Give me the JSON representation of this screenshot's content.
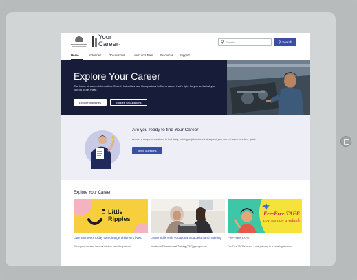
{
  "brand": {
    "name_line1": "Your",
    "name_line2": "Career",
    "trademark": "™"
  },
  "search": {
    "placeholder": "Search",
    "button_label": "Search"
  },
  "nav": {
    "items": [
      "Home",
      "Industries",
      "Occupations",
      "Learn and Train",
      "Resources",
      "Support"
    ],
    "active_index": 0
  },
  "hero": {
    "title": "Explore Your Career",
    "description": "The home of career information. Search Industries and Occupations to find a career that's right for you and what you can do to get there.",
    "button_industries": "Explore Industries",
    "button_occupations": "Explore Occupations"
  },
  "ready": {
    "title": "Are you ready to find Your Career",
    "description": "Answer a couple of questions to find study, training or job options that support your current career needs or goals.",
    "button_label": "Begin questions"
  },
  "explore": {
    "title": "Explore Your Career",
    "cards": [
      {
        "image_text_line1": "Little",
        "image_text_line2": "Ripples",
        "link": "Little moments today can change children's lives.",
        "text": "The experiences we have as children have the power to"
      },
      {
        "link": "Learn skills with Vocational Education and Training",
        "text": "Vocational Education and Training (VET) gives you job"
      },
      {
        "image_text_line1": "Fee-Free TAFE",
        "image_text_line2": "courses now available",
        "link": "Fee-Free TAFE",
        "text": "Fee-Free TAFE courses - your pathway to a meaningful career."
      }
    ]
  },
  "colors": {
    "hero_bg": "#171d38",
    "accent_blue": "#3b4ea6",
    "link_blue": "#3348b0",
    "ready_bg": "#eeeef6",
    "card1_bg": "#f7cf3c",
    "card3_bg": "#f6e33a"
  }
}
